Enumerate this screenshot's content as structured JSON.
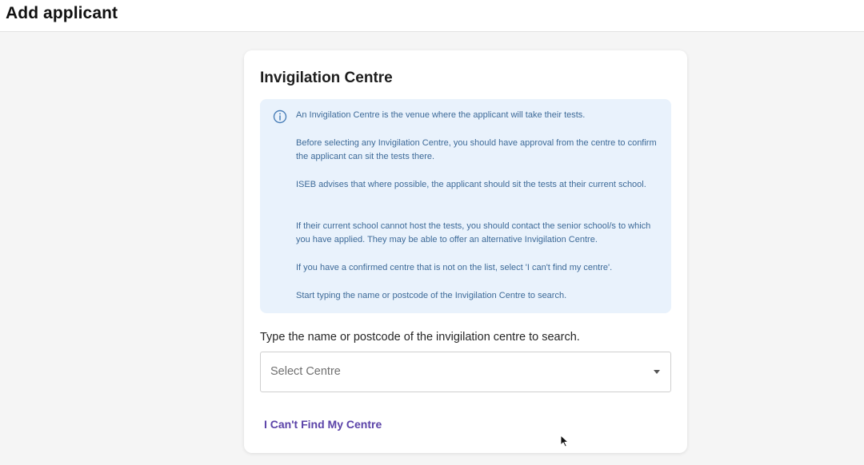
{
  "header": {
    "title": "Add applicant"
  },
  "card": {
    "title": "Invigilation Centre",
    "info": {
      "icon": "info-circle-icon",
      "paragraphs": [
        "An Invigilation Centre is the venue where the applicant will take their tests.",
        "Before selecting any Invigilation Centre, you should have approval from the centre to confirm the applicant can sit the tests there.",
        "ISEB advises that where possible, the applicant should sit the tests at their current school.",
        "If their current school cannot host the tests, you should contact the senior school/s to which you have applied. They may be able to offer an alternative Invigilation Centre.",
        "If you have a confirmed centre that is not on the list, select 'I can't find my centre'.",
        "Start typing the name or postcode of the Invigilation Centre to search."
      ]
    },
    "search_label": "Type the name or postcode of the invigilation centre to search.",
    "select": {
      "placeholder": "Select Centre"
    },
    "cant_find_link": "I Can't Find My Centre"
  },
  "colors": {
    "info_background": "#e9f2fc",
    "info_text": "#3d6a98",
    "link": "#5b43a8"
  }
}
